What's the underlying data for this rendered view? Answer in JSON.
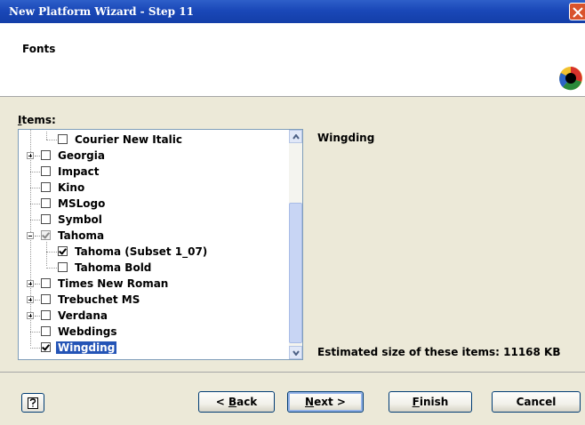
{
  "window": {
    "title": "New Platform Wizard - Step 11"
  },
  "header": {
    "title": "Fonts",
    "logo_icon": "colorwheel-logo-icon"
  },
  "items_label": {
    "prefix": "I",
    "rest": "tems:"
  },
  "tree_items": [
    {
      "label": "Courier New Italic",
      "checked": false,
      "level": 2
    },
    {
      "label": "Georgia",
      "checked": false,
      "level": 1,
      "expandable": true
    },
    {
      "label": "Impact",
      "checked": false,
      "level": 1
    },
    {
      "label": "Kino",
      "checked": false,
      "level": 1
    },
    {
      "label": "MSLogo",
      "checked": false,
      "level": 1
    },
    {
      "label": "Symbol",
      "checked": false,
      "level": 1
    },
    {
      "label": "Tahoma",
      "checked": "partial",
      "level": 1,
      "expandable": true,
      "expanded": true
    },
    {
      "label": "Tahoma (Subset 1_07)",
      "checked": true,
      "level": 2
    },
    {
      "label": "Tahoma Bold",
      "checked": false,
      "level": 2
    },
    {
      "label": "Times New Roman",
      "checked": false,
      "level": 1,
      "expandable": true
    },
    {
      "label": "Trebuchet MS",
      "checked": false,
      "level": 1,
      "expandable": true
    },
    {
      "label": "Verdana",
      "checked": false,
      "level": 1,
      "expandable": true
    },
    {
      "label": "Webdings",
      "checked": false,
      "level": 1
    },
    {
      "label": "Wingding",
      "checked": true,
      "level": 1,
      "selected": true
    }
  ],
  "details": {
    "selected_name": "Wingding",
    "size_text": "Estimated size of these items: 11168 KB"
  },
  "buttons": {
    "help_icon": "help-question-icon",
    "back": {
      "pre": "< ",
      "key": "B",
      "post": "ack"
    },
    "next": {
      "key": "N",
      "post": "ext >"
    },
    "finish": {
      "key": "F",
      "post": "inish"
    },
    "cancel": "Cancel"
  },
  "colors": {
    "titlebar": "#1a48b8",
    "selection": "#2454b6",
    "dialog_bg": "#ece9d8"
  }
}
